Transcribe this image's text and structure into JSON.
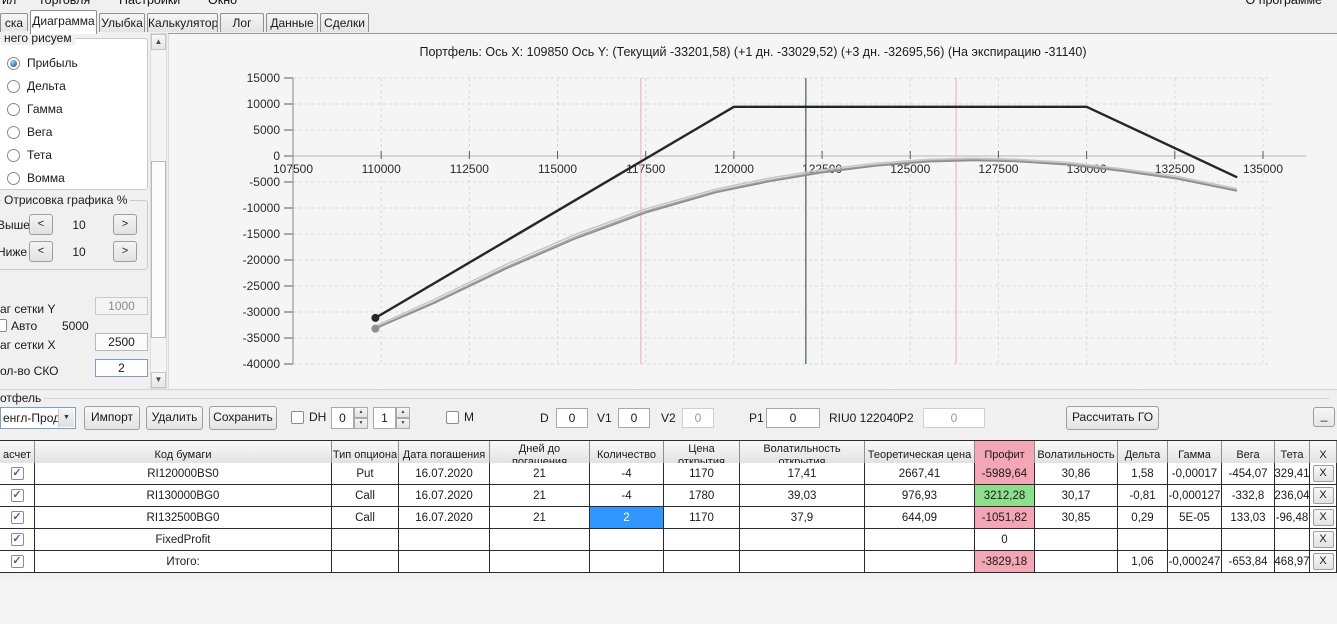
{
  "menu": {
    "items": [
      "ил",
      "Торговля",
      "Настройки",
      "Окно"
    ],
    "about": "О программе"
  },
  "tabs": {
    "items": [
      "ска",
      "Диаграмма",
      "Улыбка",
      "Калькулятор",
      "Лог",
      "Данные",
      "Сделки"
    ],
    "active": "Диаграмма"
  },
  "sidebar": {
    "draw_group_label": "него рисуем",
    "radios": [
      {
        "label": "Прибыль",
        "checked": true
      },
      {
        "label": "Дельта",
        "checked": false
      },
      {
        "label": "Гамма",
        "checked": false
      },
      {
        "label": "Вега",
        "checked": false
      },
      {
        "label": "Тета",
        "checked": false
      },
      {
        "label": "Вомма",
        "checked": false
      }
    ],
    "render_group_label": "Отрисовка графика %",
    "above_label": "Выше",
    "above_value": "10",
    "below_label": "Ниже",
    "below_value": "10",
    "step_left": "<",
    "step_right": ">",
    "grid_y_label": "аг сетки Y",
    "grid_y_value": "1000",
    "auto_label": "Авто",
    "auto_value": "5000",
    "grid_x_label": "аг сетки X",
    "grid_x_value": "2500",
    "sko_label": "ол-во СКО",
    "sko_value": "2"
  },
  "chart_data": {
    "type": "line",
    "title": "Портфель: Ось X: 109850 Ось Y: (Текущий -33201,58) (+1 дн. -33029,52) (+3 дн. -32695,56) (На экспирацию -31140)",
    "x_ticks": [
      107500,
      110000,
      112500,
      115000,
      117500,
      120000,
      122500,
      125000,
      127500,
      130000,
      132500,
      135000
    ],
    "y_ticks": [
      15000,
      10000,
      5000,
      0,
      -5000,
      -10000,
      -15000,
      -20000,
      -25000,
      -30000,
      -35000,
      -40000
    ],
    "xlim": [
      107500,
      137000
    ],
    "ylim": [
      -40000,
      15000
    ],
    "grid": true,
    "vlines": [
      {
        "name": "current-price-line",
        "x": 122040,
        "color": "#4a5568"
      },
      {
        "name": "sko-lower-line",
        "x": 117360,
        "color": "#f2b6c2"
      },
      {
        "name": "sko-upper-line",
        "x": 126300,
        "color": "#f2b6c2"
      }
    ],
    "series": [
      {
        "name": "plus-3-days",
        "label": "+3 дн.",
        "color": "#c6c6c6",
        "width": 1.5,
        "start_dot": false,
        "points": [
          [
            109836,
            -32695
          ],
          [
            111500,
            -27600
          ],
          [
            113500,
            -21000
          ],
          [
            115500,
            -15100
          ],
          [
            117500,
            -10150
          ],
          [
            119500,
            -6350
          ],
          [
            121000,
            -4250
          ],
          [
            122500,
            -2650
          ],
          [
            124000,
            -1400
          ],
          [
            125500,
            -650
          ],
          [
            126800,
            -420
          ],
          [
            128000,
            -620
          ],
          [
            129500,
            -1250
          ],
          [
            131000,
            -2450
          ],
          [
            132500,
            -3850
          ],
          [
            134244,
            -6250
          ]
        ]
      },
      {
        "name": "plus-1-day",
        "label": "+1 дн.",
        "color": "#a9a9a9",
        "width": 1.5,
        "start_dot": false,
        "points": [
          [
            109836,
            -33029
          ],
          [
            111500,
            -28050
          ],
          [
            113500,
            -21500
          ],
          [
            115500,
            -15600
          ],
          [
            117500,
            -10600
          ],
          [
            119500,
            -6750
          ],
          [
            121000,
            -4650
          ],
          [
            122500,
            -3000
          ],
          [
            124000,
            -1750
          ],
          [
            125500,
            -950
          ],
          [
            126800,
            -700
          ],
          [
            128000,
            -900
          ],
          [
            129500,
            -1550
          ],
          [
            131000,
            -2750
          ],
          [
            132500,
            -4150
          ],
          [
            134244,
            -6550
          ]
        ]
      },
      {
        "name": "current",
        "label": "Текущий",
        "color": "#8e8e8e",
        "width": 1.6,
        "start_dot": true,
        "points": [
          [
            109836,
            -33201
          ],
          [
            111500,
            -28300
          ],
          [
            113500,
            -21800
          ],
          [
            115500,
            -15900
          ],
          [
            117500,
            -10900
          ],
          [
            119500,
            -7000
          ],
          [
            121000,
            -4900
          ],
          [
            122500,
            -3200
          ],
          [
            124000,
            -1900
          ],
          [
            125500,
            -1100
          ],
          [
            126800,
            -850
          ],
          [
            128000,
            -1050
          ],
          [
            129500,
            -1700
          ],
          [
            131000,
            -2900
          ],
          [
            132500,
            -4300
          ],
          [
            134244,
            -6700
          ]
        ]
      },
      {
        "name": "expiration",
        "label": "На экспирацию",
        "color": "#262626",
        "width": 2.4,
        "start_dot": true,
        "points": [
          [
            109836,
            -31140
          ],
          [
            120000,
            9460
          ],
          [
            130000,
            9460
          ],
          [
            134244,
            -4028
          ]
        ]
      }
    ]
  },
  "toolbar": {
    "group_label": "отфель",
    "portfolio_combo": "енгл-Прод",
    "import_label": "Импорт",
    "delete_label": "Удалить",
    "save_label": "Сохранить",
    "dh_label": "DH",
    "spin1_value": "0",
    "spin2_value": "1",
    "m_label": "M",
    "d_label": "D",
    "d_value": "0",
    "v1_label": "V1",
    "v1_value": "0",
    "v2_label": "V2",
    "v2_value": "0",
    "p1_label": "P1",
    "p1_value": "0",
    "instrument_label": "RIU0 122040",
    "p2_label": "P2",
    "p2_value": "0",
    "calc_go_label": "Рассчитать ГО",
    "minimize_label": "_"
  },
  "table": {
    "headers": [
      "асчет",
      "Код бумаги",
      "Тип опциона",
      "Дата погашения",
      "Дней до погашения",
      "Количество",
      "Цена открытия",
      "Волатильность открытия",
      "Теоретическая цена",
      "Профит",
      "Волатильность",
      "Дельта",
      "Гамма",
      "Вега",
      "Тета",
      "X"
    ],
    "profit_header_color": "#f3a6b6",
    "close_label": "X",
    "rows": [
      {
        "checked": true,
        "profit_color": "red",
        "qty_selected": false,
        "cells": [
          "RI120000BS0",
          "Put",
          "16.07.2020",
          "21",
          "-4",
          "1170",
          "17,41",
          "2667,41",
          "-5989,64",
          "30,86",
          "1,58",
          "-0,00017",
          "-454,07",
          "329,41"
        ]
      },
      {
        "checked": true,
        "profit_color": "green",
        "qty_selected": false,
        "cells": [
          "RI130000BG0",
          "Call",
          "16.07.2020",
          "21",
          "-4",
          "1780",
          "39,03",
          "976,93",
          "3212,28",
          "30,17",
          "-0,81",
          "-0,000127",
          "-332,8",
          "236,04"
        ]
      },
      {
        "checked": true,
        "profit_color": "red",
        "qty_selected": true,
        "cells": [
          "RI132500BG0",
          "Call",
          "16.07.2020",
          "21",
          "2",
          "1170",
          "37,9",
          "644,09",
          "-1051,82",
          "30,85",
          "0,29",
          "5E-05",
          "133,03",
          "-96,48"
        ]
      },
      {
        "checked": true,
        "profit_color": null,
        "qty_selected": false,
        "cells": [
          "FixedProfit",
          "",
          "",
          "",
          "",
          "",
          "",
          "",
          "0",
          "",
          "",
          "",
          "",
          ""
        ]
      },
      {
        "checked": true,
        "profit_color": "red",
        "qty_selected": false,
        "cells": [
          "Итого:",
          "",
          "",
          "",
          "",
          "",
          "",
          "",
          "-3829,18",
          "",
          "1,06",
          "-0,000247",
          "-653,84",
          "468,97"
        ]
      }
    ]
  }
}
